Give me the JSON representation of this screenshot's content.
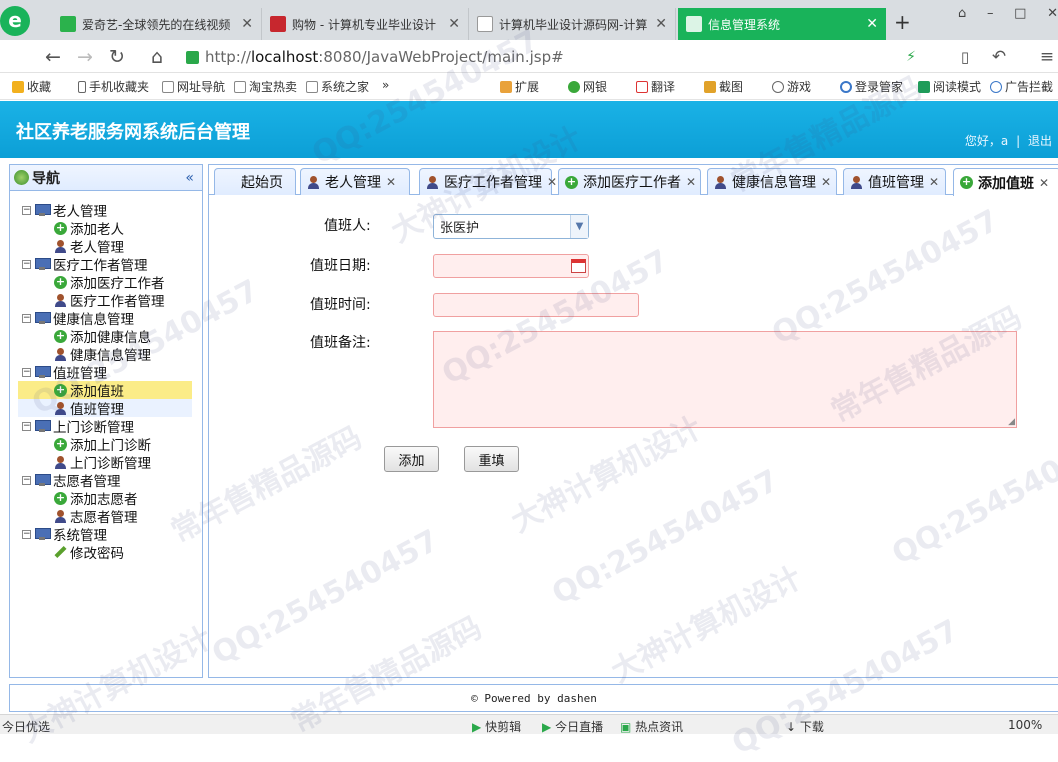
{
  "browser": {
    "tabs": [
      {
        "title": "爱奇艺-全球领先的在线视频"
      },
      {
        "title": "购物 - 计算机专业毕业设计"
      },
      {
        "title": "计算机毕业设计源码网-计算"
      },
      {
        "title": "信息管理系统"
      }
    ],
    "new_tab": "+",
    "window_controls": [
      "⌂",
      "–",
      "□",
      "✕"
    ],
    "url_scheme": "http://",
    "url_host": "localhost",
    "url_path": ":8080/JavaWebProject/main.jsp#",
    "bookmarks": [
      "收藏",
      "手机收藏夹",
      "网址导航",
      "淘宝热卖",
      "系统之家",
      "»"
    ],
    "toolbar_right": [
      "扩展",
      "网银",
      "翻译",
      "截图",
      "游戏",
      "登录管家",
      "阅读模式",
      "广告拦截"
    ]
  },
  "app": {
    "title": "社区养老服务网系统后台管理",
    "welcome": "您好，a",
    "logout": "退出"
  },
  "nav": {
    "title": "导航",
    "collapse": "«",
    "tree": [
      {
        "label": "老人管理",
        "children": [
          "添加老人",
          "老人管理"
        ]
      },
      {
        "label": "医疗工作者管理",
        "children": [
          "添加医疗工作者",
          "医疗工作者管理"
        ]
      },
      {
        "label": "健康信息管理",
        "children": [
          "添加健康信息",
          "健康信息管理"
        ]
      },
      {
        "label": "值班管理",
        "children": [
          "添加值班",
          "值班管理"
        ]
      },
      {
        "label": "上门诊断管理",
        "children": [
          "添加上门诊断",
          "上门诊断管理"
        ]
      },
      {
        "label": "志愿者管理",
        "children": [
          "添加志愿者",
          "志愿者管理"
        ]
      },
      {
        "label": "系统管理",
        "children": [
          "修改密码"
        ]
      }
    ],
    "selected": "添加值班"
  },
  "tabs": [
    {
      "label": "起始页",
      "icon": "none"
    },
    {
      "label": "老人管理",
      "icon": "user-icon"
    },
    {
      "label": "医疗工作者管理",
      "icon": "user-icon"
    },
    {
      "label": "添加医疗工作者",
      "icon": "add-icon"
    },
    {
      "label": "健康信息管理",
      "icon": "user-icon"
    },
    {
      "label": "值班管理",
      "icon": "user-icon"
    },
    {
      "label": "添加值班",
      "icon": "add-icon"
    }
  ],
  "form": {
    "person_label": "值班人:",
    "person_value": "张医护",
    "date_label": "值班日期:",
    "date_value": "",
    "time_label": "值班时间:",
    "time_value": "",
    "memo_label": "值班备注:",
    "memo_value": "",
    "add_button": "添加",
    "reset_button": "重填"
  },
  "footer": {
    "text": "© Powered by dashen"
  },
  "status_bar": {
    "left": "今日优选",
    "items": [
      "快剪辑",
      "今日直播",
      "热点资讯",
      "下载"
    ],
    "zoom": "100%"
  },
  "watermarks": [
    "QQ:254540457",
    "大神计算机设计",
    "常年售精品源码"
  ],
  "colors": {
    "header": "#12a9e0",
    "active_tab": "#19b35a",
    "panel_border": "#95b8e7",
    "selected_node": "#fbec88"
  }
}
